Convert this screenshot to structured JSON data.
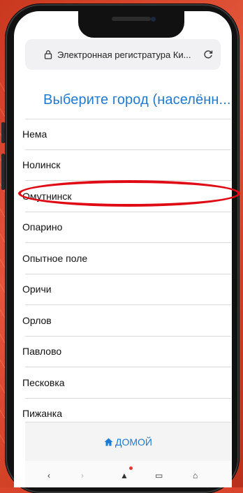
{
  "browser": {
    "address_text": "Электронная регистратура Ки..."
  },
  "page": {
    "title": "Выберите город (населённ..."
  },
  "list": {
    "items": [
      "Нема",
      "Нолинск",
      "Омутнинск",
      "Опарино",
      "Опытное поле",
      "Оричи",
      "Орлов",
      "Павлово",
      "Песковка",
      "Пижанка"
    ],
    "highlighted_item": "Омутнинск"
  },
  "footer": {
    "home_label": "ДОМОЙ",
    "home_icon": "home-icon"
  },
  "colors": {
    "accent": "#1f7ad1",
    "highlight_ring": "#e00a14",
    "background": "#d8442c"
  }
}
